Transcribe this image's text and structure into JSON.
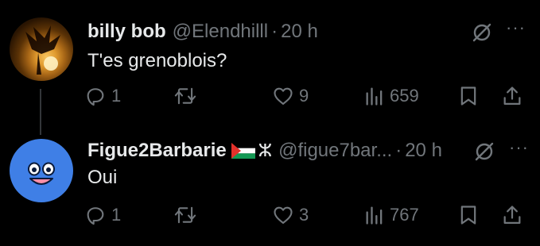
{
  "tweets": [
    {
      "name": "billy bob",
      "handle": "@Elendhilll",
      "dot": "·",
      "time": "20 h",
      "text": "T'es grenoblois?",
      "replies": "1",
      "likes": "9",
      "views": "659"
    },
    {
      "name": "Figue2Barbarie",
      "flag_emoji": "🇵🇸",
      "amazigh_symbol": "ⵣ",
      "handle": "@figue7bar...",
      "dot": "·",
      "time": "20 h",
      "text": "Oui",
      "replies": "1",
      "likes": "3",
      "views": "767"
    }
  ],
  "icons": {
    "reply": "reply-icon",
    "retweet": "retweet-icon",
    "like": "heart-icon",
    "views": "views-icon",
    "bookmark": "bookmark-icon",
    "share": "share-icon",
    "grok": "grok-icon",
    "more": "more-icon"
  },
  "colors": {
    "background": "#000000",
    "primary_text": "#e7e9ea",
    "secondary_text": "#71767b",
    "thread_line": "#333639",
    "avatar_blue": "#3f7fe6"
  }
}
